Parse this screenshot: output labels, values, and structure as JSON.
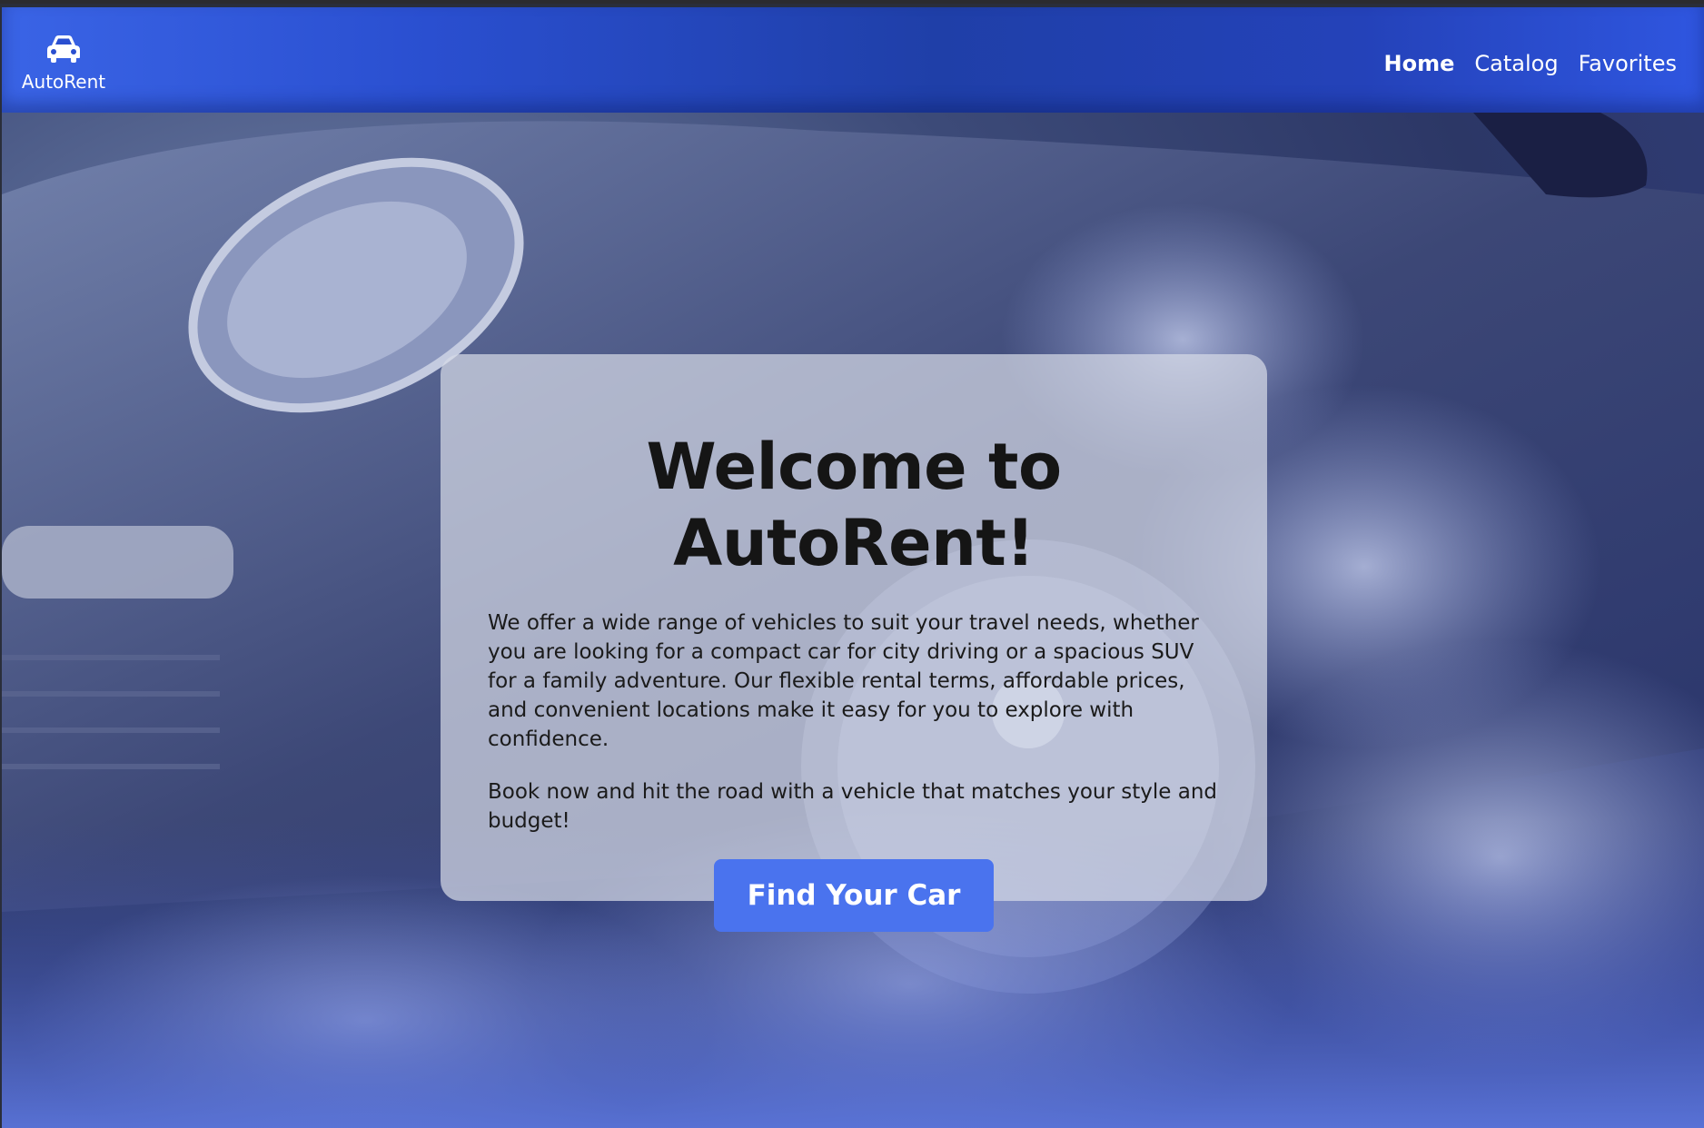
{
  "header": {
    "logo_text": "AutoRent",
    "logo_icon": "car-icon",
    "nav": [
      {
        "label": "Home",
        "active": true
      },
      {
        "label": "Catalog",
        "active": false
      },
      {
        "label": "Favorites",
        "active": false
      }
    ]
  },
  "hero": {
    "background": "car-wheel-smoke-photo",
    "title": "Welcome to AutoRent!",
    "paragraph1": "We offer a wide range of vehicles to suit your travel needs, whether you are looking for a compact car for city driving or a spacious SUV for a family adventure. Our flexible rental terms, affordable prices, and convenient locations make it easy for you to explore with confidence.",
    "paragraph2": "Book now and hit the road with a vehicle that matches your style and budget!",
    "cta_label": "Find Your Car"
  },
  "colors": {
    "header": "#2a4fd0",
    "accent": "#4a73ee",
    "card": "#d6dae6",
    "text": "#151515"
  }
}
